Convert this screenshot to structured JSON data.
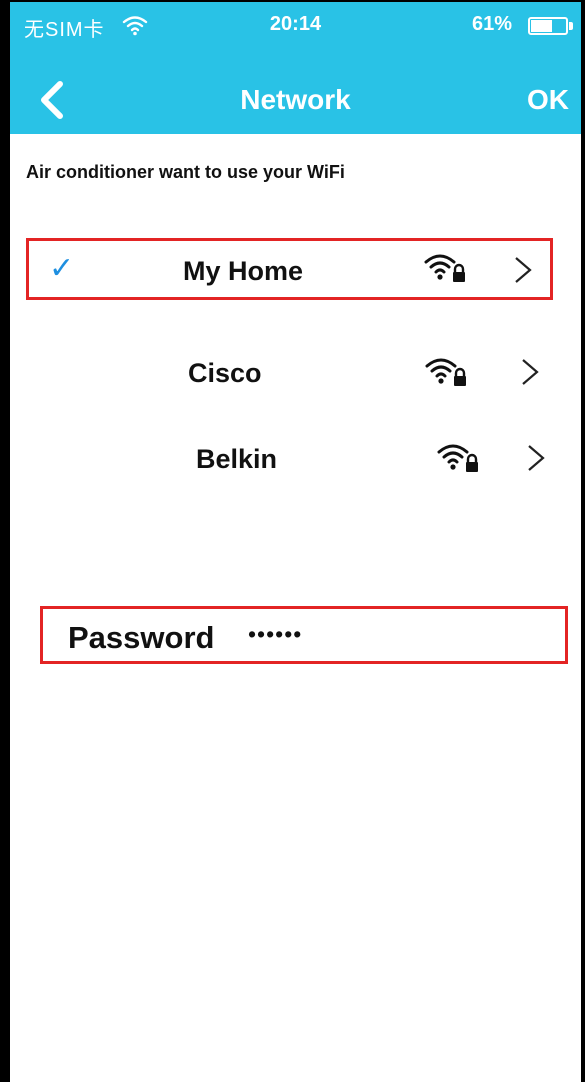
{
  "status_bar": {
    "carrier": "无SIM卡",
    "time": "20:14",
    "battery_percent": "61%",
    "battery_level": 0.61
  },
  "nav": {
    "title": "Network",
    "ok_label": "OK"
  },
  "prompt": "Air conditioner want to use your WiFi",
  "networks": [
    {
      "name": "My Home",
      "selected": true,
      "secured": true
    },
    {
      "name": "Cisco",
      "selected": false,
      "secured": true
    },
    {
      "name": "Belkin",
      "selected": false,
      "secured": true
    }
  ],
  "password": {
    "label": "Password",
    "value": "••••••"
  },
  "colors": {
    "header": "#29c2e6",
    "highlight_border": "#e32424",
    "check": "#1e8fe0"
  },
  "icons": {
    "status_wifi": "wifi-icon",
    "back": "chevron-left-icon",
    "check": "checkmark-icon",
    "secured_wifi": "wifi-lock-icon",
    "row_arrow": "chevron-right-icon"
  }
}
